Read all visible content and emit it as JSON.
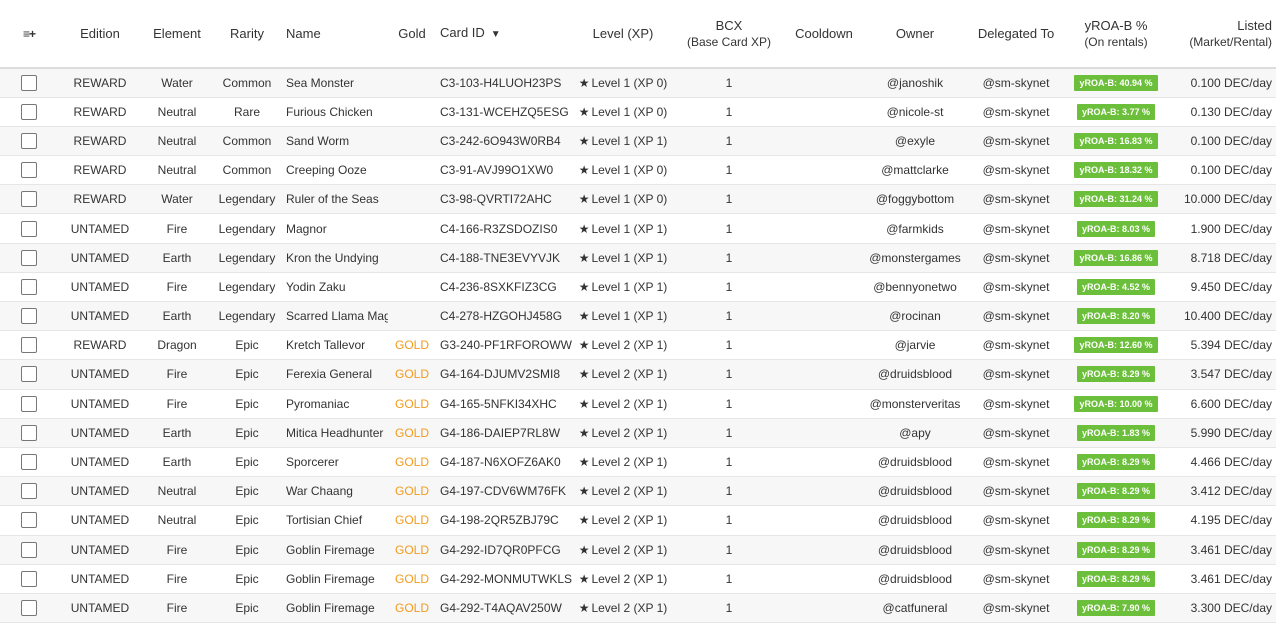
{
  "header": {
    "menu_icon": "≡+",
    "edition": "Edition",
    "element": "Element",
    "rarity": "Rarity",
    "name": "Name",
    "gold": "Gold",
    "card_id": "Card ID",
    "level": "Level (XP)",
    "bcx_line1": "BCX",
    "bcx_line2": "(Base Card XP)",
    "cooldown": "Cooldown",
    "owner": "Owner",
    "delegated": "Delegated To",
    "yroa_line1": "yROA-B %",
    "yroa_line2": "(On rentals)",
    "listed_line1": "Listed",
    "listed_line2": "(Market/Rental)"
  },
  "colors": {
    "gold": "#f29b1d",
    "badge": "#6cbf3b"
  },
  "rows": [
    {
      "edition": "REWARD",
      "element": "Water",
      "rarity": "Common",
      "name": "Sea Monster",
      "gold": "",
      "card_id": "C3-103-H4LUOH23PS",
      "level": "Level 1",
      "xp": "(XP 0)",
      "bcx": "1",
      "owner": "@janoshik",
      "delegated": "@sm-skynet",
      "yroa": "yROA-B: 40.94 %",
      "listed": "0.100 DEC/day"
    },
    {
      "edition": "REWARD",
      "element": "Neutral",
      "rarity": "Rare",
      "name": "Furious Chicken",
      "gold": "",
      "card_id": "C3-131-WCEHZQ5ESG",
      "level": "Level 1",
      "xp": "(XP 0)",
      "bcx": "1",
      "owner": "@nicole-st",
      "delegated": "@sm-skynet",
      "yroa": "yROA-B: 3.77 %",
      "listed": "0.130 DEC/day"
    },
    {
      "edition": "REWARD",
      "element": "Neutral",
      "rarity": "Common",
      "name": "Sand Worm",
      "gold": "",
      "card_id": "C3-242-6O943W0RB4",
      "level": "Level 1",
      "xp": "(XP 1)",
      "bcx": "1",
      "owner": "@exyle",
      "delegated": "@sm-skynet",
      "yroa": "yROA-B: 16.83 %",
      "listed": "0.100 DEC/day"
    },
    {
      "edition": "REWARD",
      "element": "Neutral",
      "rarity": "Common",
      "name": "Creeping Ooze",
      "gold": "",
      "card_id": "C3-91-AVJ99O1XW0",
      "level": "Level 1",
      "xp": "(XP 0)",
      "bcx": "1",
      "owner": "@mattclarke",
      "delegated": "@sm-skynet",
      "yroa": "yROA-B: 18.32 %",
      "listed": "0.100 DEC/day"
    },
    {
      "edition": "REWARD",
      "element": "Water",
      "rarity": "Legendary",
      "name": "Ruler of the Seas",
      "gold": "",
      "card_id": "C3-98-QVRTI72AHC",
      "level": "Level 1",
      "xp": "(XP 0)",
      "bcx": "1",
      "owner": "@foggybottom",
      "delegated": "@sm-skynet",
      "yroa": "yROA-B: 31.24 %",
      "listed": "10.000 DEC/day"
    },
    {
      "edition": "UNTAMED",
      "element": "Fire",
      "rarity": "Legendary",
      "name": "Magnor",
      "gold": "",
      "card_id": "C4-166-R3ZSDOZIS0",
      "level": "Level 1",
      "xp": "(XP 1)",
      "bcx": "1",
      "owner": "@farmkids",
      "delegated": "@sm-skynet",
      "yroa": "yROA-B: 8.03 %",
      "listed": "1.900 DEC/day"
    },
    {
      "edition": "UNTAMED",
      "element": "Earth",
      "rarity": "Legendary",
      "name": "Kron the Undying",
      "gold": "",
      "card_id": "C4-188-TNE3EVYVJK",
      "level": "Level 1",
      "xp": "(XP 1)",
      "bcx": "1",
      "owner": "@monstergames",
      "delegated": "@sm-skynet",
      "yroa": "yROA-B: 16.86 %",
      "listed": "8.718 DEC/day"
    },
    {
      "edition": "UNTAMED",
      "element": "Fire",
      "rarity": "Legendary",
      "name": "Yodin Zaku",
      "gold": "",
      "card_id": "C4-236-8SXKFIZ3CG",
      "level": "Level 1",
      "xp": "(XP 1)",
      "bcx": "1",
      "owner": "@bennyonetwo",
      "delegated": "@sm-skynet",
      "yroa": "yROA-B: 4.52 %",
      "listed": "9.450 DEC/day"
    },
    {
      "edition": "UNTAMED",
      "element": "Earth",
      "rarity": "Legendary",
      "name": "Scarred Llama Mage",
      "gold": "",
      "card_id": "C4-278-HZGOHJ458G",
      "level": "Level 1",
      "xp": "(XP 1)",
      "bcx": "1",
      "owner": "@rocinan",
      "delegated": "@sm-skynet",
      "yroa": "yROA-B: 8.20 %",
      "listed": "10.400 DEC/day"
    },
    {
      "edition": "REWARD",
      "element": "Dragon",
      "rarity": "Epic",
      "name": "Kretch Tallevor",
      "gold": "GOLD",
      "card_id": "G3-240-PF1RFOROWW",
      "level": "Level 2",
      "xp": "(XP 1)",
      "bcx": "1",
      "owner": "@jarvie",
      "delegated": "@sm-skynet",
      "yroa": "yROA-B: 12.60 %",
      "listed": "5.394 DEC/day"
    },
    {
      "edition": "UNTAMED",
      "element": "Fire",
      "rarity": "Epic",
      "name": "Ferexia General",
      "gold": "GOLD",
      "card_id": "G4-164-DJUMV2SMI8",
      "level": "Level 2",
      "xp": "(XP 1)",
      "bcx": "1",
      "owner": "@druidsblood",
      "delegated": "@sm-skynet",
      "yroa": "yROA-B: 8.29 %",
      "listed": "3.547 DEC/day"
    },
    {
      "edition": "UNTAMED",
      "element": "Fire",
      "rarity": "Epic",
      "name": "Pyromaniac",
      "gold": "GOLD",
      "card_id": "G4-165-5NFKI34XHC",
      "level": "Level 2",
      "xp": "(XP 1)",
      "bcx": "1",
      "owner": "@monsterveritas",
      "delegated": "@sm-skynet",
      "yroa": "yROA-B: 10.00 %",
      "listed": "6.600 DEC/day"
    },
    {
      "edition": "UNTAMED",
      "element": "Earth",
      "rarity": "Epic",
      "name": "Mitica Headhunter",
      "gold": "GOLD",
      "card_id": "G4-186-DAIEP7RL8W",
      "level": "Level 2",
      "xp": "(XP 1)",
      "bcx": "1",
      "owner": "@apy",
      "delegated": "@sm-skynet",
      "yroa": "yROA-B: 1.83 %",
      "listed": "5.990 DEC/day"
    },
    {
      "edition": "UNTAMED",
      "element": "Earth",
      "rarity": "Epic",
      "name": "Sporcerer",
      "gold": "GOLD",
      "card_id": "G4-187-N6XOFZ6AK0",
      "level": "Level 2",
      "xp": "(XP 1)",
      "bcx": "1",
      "owner": "@druidsblood",
      "delegated": "@sm-skynet",
      "yroa": "yROA-B: 8.29 %",
      "listed": "4.466 DEC/day"
    },
    {
      "edition": "UNTAMED",
      "element": "Neutral",
      "rarity": "Epic",
      "name": "War Chaang",
      "gold": "GOLD",
      "card_id": "G4-197-CDV6WM76FK",
      "level": "Level 2",
      "xp": "(XP 1)",
      "bcx": "1",
      "owner": "@druidsblood",
      "delegated": "@sm-skynet",
      "yroa": "yROA-B: 8.29 %",
      "listed": "3.412 DEC/day"
    },
    {
      "edition": "UNTAMED",
      "element": "Neutral",
      "rarity": "Epic",
      "name": "Tortisian Chief",
      "gold": "GOLD",
      "card_id": "G4-198-2QR5ZBJ79C",
      "level": "Level 2",
      "xp": "(XP 1)",
      "bcx": "1",
      "owner": "@druidsblood",
      "delegated": "@sm-skynet",
      "yroa": "yROA-B: 8.29 %",
      "listed": "4.195 DEC/day"
    },
    {
      "edition": "UNTAMED",
      "element": "Fire",
      "rarity": "Epic",
      "name": "Goblin Firemage",
      "gold": "GOLD",
      "card_id": "G4-292-ID7QR0PFCG",
      "level": "Level 2",
      "xp": "(XP 1)",
      "bcx": "1",
      "owner": "@druidsblood",
      "delegated": "@sm-skynet",
      "yroa": "yROA-B: 8.29 %",
      "listed": "3.461 DEC/day"
    },
    {
      "edition": "UNTAMED",
      "element": "Fire",
      "rarity": "Epic",
      "name": "Goblin Firemage",
      "gold": "GOLD",
      "card_id": "G4-292-MONMUTWKLS",
      "level": "Level 2",
      "xp": "(XP 1)",
      "bcx": "1",
      "owner": "@druidsblood",
      "delegated": "@sm-skynet",
      "yroa": "yROA-B: 8.29 %",
      "listed": "3.461 DEC/day"
    },
    {
      "edition": "UNTAMED",
      "element": "Fire",
      "rarity": "Epic",
      "name": "Goblin Firemage",
      "gold": "GOLD",
      "card_id": "G4-292-T4AQAV250W",
      "level": "Level 2",
      "xp": "(XP 1)",
      "bcx": "1",
      "owner": "@catfuneral",
      "delegated": "@sm-skynet",
      "yroa": "yROA-B: 7.90 %",
      "listed": "3.300 DEC/day"
    }
  ]
}
